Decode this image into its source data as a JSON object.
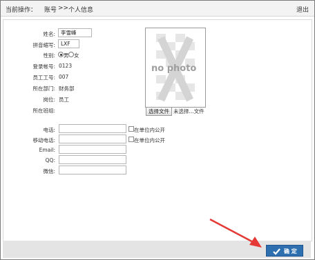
{
  "header": {
    "current_op": "当前操作：",
    "item1": "账号",
    "sep": ">>",
    "item2": "个人信息",
    "logout": "退出"
  },
  "form": {
    "name_label": "姓名:",
    "name_value": "李雪峰",
    "pinyin_label": "拼音缩写:",
    "pinyin_value": "LXF",
    "gender_label": "性别:",
    "gender_male": "男",
    "gender_female": "女",
    "gender_selected": "男",
    "login_label": "登录帐号:",
    "login_value": "0123",
    "empno_label": "员工工号:",
    "empno_value": "007",
    "dept_label": "所在部门:",
    "dept_value": "财务部",
    "post_label": "岗位:",
    "post_value": "员工",
    "group_label": "所在班组:",
    "phone_label": "电话:",
    "mobile_label": "移动电话:",
    "email_label": "Email:",
    "qq_label": "QQ:",
    "wechat_label": "微信:",
    "public_label": "在单位内公开"
  },
  "photo": {
    "text": "no photo",
    "choose_button": "选择文件",
    "no_file": "未选择...文件"
  },
  "footer": {
    "ok_label": "确 定"
  },
  "colors": {
    "ok_button": "#2e6fb0",
    "arrow": "#e53935"
  }
}
